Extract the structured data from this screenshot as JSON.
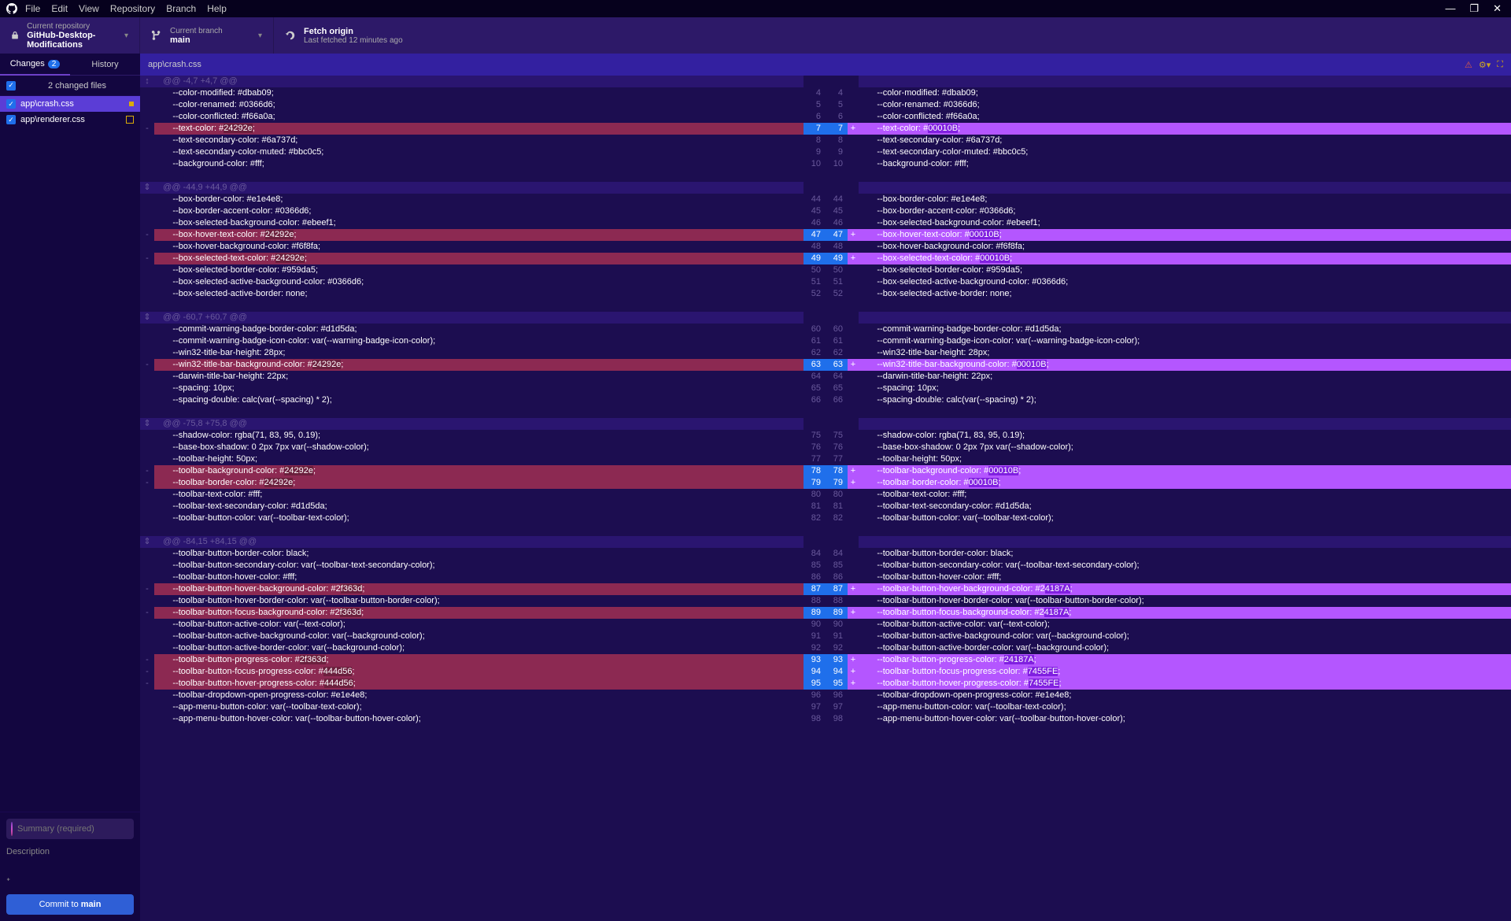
{
  "menubar": [
    "File",
    "Edit",
    "View",
    "Repository",
    "Branch",
    "Help"
  ],
  "repo": {
    "label": "Current repository",
    "value": "GitHub-Desktop-Modifications"
  },
  "branch": {
    "label": "Current branch",
    "value": "main"
  },
  "fetch": {
    "title": "Fetch origin",
    "sub": "Last fetched 12 minutes ago"
  },
  "tabs": {
    "changes": "Changes",
    "changes_count": "2",
    "history": "History"
  },
  "changed_header": "2 changed files",
  "files": [
    {
      "path": "app\\crash.css",
      "active": true,
      "icon": "dot"
    },
    {
      "path": "app\\renderer.css",
      "active": false,
      "icon": "square"
    }
  ],
  "filebar": "app\\crash.css",
  "commit": {
    "summary_ph": "Summary (required)",
    "desc": "Description",
    "button_pre": "Commit to ",
    "button_branch": "main"
  },
  "diff": [
    {
      "t": "hunk",
      "gut": "↕",
      "txt": "@@ -4,7 +4,7 @@"
    },
    {
      "t": "ctx",
      "l": "4",
      "r": "4",
      "txt": "    --color-modified: #dbab09;"
    },
    {
      "t": "ctx",
      "l": "5",
      "r": "5",
      "txt": "    --color-renamed: #0366d6;"
    },
    {
      "t": "ctx",
      "l": "6",
      "r": "6",
      "txt": "    --color-conflicted: #f66a0a;"
    },
    {
      "t": "chg",
      "l": "7",
      "r": "7",
      "old": "    --text-color: #",
      "oldh": "24292e",
      "olde": ";",
      "new": "    --text-color: #",
      "newh": "00010B",
      "newe": ";"
    },
    {
      "t": "ctx",
      "l": "8",
      "r": "8",
      "txt": "    --text-secondary-color: #6a737d;"
    },
    {
      "t": "ctx",
      "l": "9",
      "r": "9",
      "txt": "    --text-secondary-color-muted: #bbc0c5;"
    },
    {
      "t": "ctx",
      "l": "10",
      "r": "10",
      "txt": "    --background-color: #fff;"
    },
    {
      "t": "hunk",
      "gut": "⇕",
      "txt": "@@ -44,9 +44,9 @@"
    },
    {
      "t": "ctx",
      "l": "44",
      "r": "44",
      "txt": "    --box-border-color: #e1e4e8;"
    },
    {
      "t": "ctx",
      "l": "45",
      "r": "45",
      "txt": "    --box-border-accent-color: #0366d6;"
    },
    {
      "t": "ctx",
      "l": "46",
      "r": "46",
      "txt": "    --box-selected-background-color: #ebeef1;"
    },
    {
      "t": "chg",
      "l": "47",
      "r": "47",
      "old": "    --box-hover-text-color: #",
      "oldh": "24292e",
      "olde": ";",
      "new": "    --box-hover-text-color: #",
      "newh": "00010B",
      "newe": ";"
    },
    {
      "t": "ctx",
      "l": "48",
      "r": "48",
      "txt": "    --box-hover-background-color: #f6f8fa;"
    },
    {
      "t": "chg",
      "l": "49",
      "r": "49",
      "old": "    --box-selected-text-color: #",
      "oldh": "24292e",
      "olde": ";",
      "new": "    --box-selected-text-color: #",
      "newh": "00010B",
      "newe": ";"
    },
    {
      "t": "ctx",
      "l": "50",
      "r": "50",
      "txt": "    --box-selected-border-color: #959da5;"
    },
    {
      "t": "ctx",
      "l": "51",
      "r": "51",
      "txt": "    --box-selected-active-background-color: #0366d6;"
    },
    {
      "t": "ctx",
      "l": "52",
      "r": "52",
      "txt": "    --box-selected-active-border: none;"
    },
    {
      "t": "hunk",
      "gut": "⇕",
      "txt": "@@ -60,7 +60,7 @@"
    },
    {
      "t": "ctx",
      "l": "60",
      "r": "60",
      "txt": "    --commit-warning-badge-border-color: #d1d5da;"
    },
    {
      "t": "ctx",
      "l": "61",
      "r": "61",
      "txt": "    --commit-warning-badge-icon-color: var(--warning-badge-icon-color);"
    },
    {
      "t": "ctx",
      "l": "62",
      "r": "62",
      "txt": "    --win32-title-bar-height: 28px;"
    },
    {
      "t": "chg",
      "l": "63",
      "r": "63",
      "old": "    --win32-title-bar-background-color: #",
      "oldh": "24292e",
      "olde": ";",
      "new": "    --win32-title-bar-background-color: #",
      "newh": "00010B",
      "newe": ";"
    },
    {
      "t": "ctx",
      "l": "64",
      "r": "64",
      "txt": "    --darwin-title-bar-height: 22px;"
    },
    {
      "t": "ctx",
      "l": "65",
      "r": "65",
      "txt": "    --spacing: 10px;"
    },
    {
      "t": "ctx",
      "l": "66",
      "r": "66",
      "txt": "    --spacing-double: calc(var(--spacing) * 2);"
    },
    {
      "t": "hunk",
      "gut": "⇕",
      "txt": "@@ -75,8 +75,8 @@"
    },
    {
      "t": "ctx",
      "l": "75",
      "r": "75",
      "txt": "    --shadow-color: rgba(71, 83, 95, 0.19);"
    },
    {
      "t": "ctx",
      "l": "76",
      "r": "76",
      "txt": "    --base-box-shadow: 0 2px 7px var(--shadow-color);"
    },
    {
      "t": "ctx",
      "l": "77",
      "r": "77",
      "txt": "    --toolbar-height: 50px;"
    },
    {
      "t": "chg",
      "l": "78",
      "r": "78",
      "old": "    --toolbar-background-color: #",
      "oldh": "24292e",
      "olde": ";",
      "new": "    --toolbar-background-color: #",
      "newh": "00010B",
      "newe": ";"
    },
    {
      "t": "chg",
      "l": "79",
      "r": "79",
      "old": "    --toolbar-border-color: #",
      "oldh": "24292e",
      "olde": ";",
      "new": "    --toolbar-border-color: #",
      "newh": "00010B",
      "newe": ";"
    },
    {
      "t": "ctx",
      "l": "80",
      "r": "80",
      "txt": "    --toolbar-text-color: #fff;"
    },
    {
      "t": "ctx",
      "l": "81",
      "r": "81",
      "txt": "    --toolbar-text-secondary-color: #d1d5da;"
    },
    {
      "t": "ctx",
      "l": "82",
      "r": "82",
      "txt": "    --toolbar-button-color: var(--toolbar-text-color);"
    },
    {
      "t": "hunk",
      "gut": "⇕",
      "txt": "@@ -84,15 +84,15 @@"
    },
    {
      "t": "ctx",
      "l": "84",
      "r": "84",
      "txt": "    --toolbar-button-border-color: black;"
    },
    {
      "t": "ctx",
      "l": "85",
      "r": "85",
      "txt": "    --toolbar-button-secondary-color: var(--toolbar-text-secondary-color);"
    },
    {
      "t": "ctx",
      "l": "86",
      "r": "86",
      "txt": "    --toolbar-button-hover-color: #fff;"
    },
    {
      "t": "chg",
      "l": "87",
      "r": "87",
      "old": "    --toolbar-button-hover-background-color: #2",
      "oldh": "f363d",
      "olde": ";",
      "new": "    --toolbar-button-hover-background-color: #2",
      "newh": "4187A",
      "newe": ";"
    },
    {
      "t": "ctx",
      "l": "88",
      "r": "88",
      "txt": "    --toolbar-button-hover-border-color: var(--toolbar-button-border-color);"
    },
    {
      "t": "chg",
      "l": "89",
      "r": "89",
      "old": "    --toolbar-button-focus-background-color: #2",
      "oldh": "f363d",
      "olde": ";",
      "new": "    --toolbar-button-focus-background-color: #2",
      "newh": "4187A",
      "newe": ";"
    },
    {
      "t": "ctx",
      "l": "90",
      "r": "90",
      "txt": "    --toolbar-button-active-color: var(--text-color);"
    },
    {
      "t": "ctx",
      "l": "91",
      "r": "91",
      "txt": "    --toolbar-button-active-background-color: var(--background-color);"
    },
    {
      "t": "ctx",
      "l": "92",
      "r": "92",
      "txt": "    --toolbar-button-active-border-color: var(--background-color);"
    },
    {
      "t": "chg",
      "l": "93",
      "r": "93",
      "old": "    --toolbar-button-progress-color: #",
      "oldh": "2f363d",
      "olde": ";",
      "new": "    --toolbar-button-progress-color: #",
      "newh": "24187A",
      "newe": ";"
    },
    {
      "t": "chg",
      "l": "94",
      "r": "94",
      "old": "    --toolbar-button-focus-progress-color: #",
      "oldh": "444d56",
      "olde": ";",
      "new": "    --toolbar-button-focus-progress-color: #",
      "newh": "7455FE",
      "newe": ";"
    },
    {
      "t": "chg",
      "l": "95",
      "r": "95",
      "old": "    --toolbar-button-hover-progress-color: #",
      "oldh": "444d56",
      "olde": ";",
      "new": "    --toolbar-button-hover-progress-color: #",
      "newh": "7455FE",
      "newe": ";"
    },
    {
      "t": "ctx",
      "l": "96",
      "r": "96",
      "txt": "    --toolbar-dropdown-open-progress-color: #e1e4e8;"
    },
    {
      "t": "ctx",
      "l": "97",
      "r": "97",
      "txt": "    --app-menu-button-color: var(--toolbar-text-color);"
    },
    {
      "t": "ctx",
      "l": "98",
      "r": "98",
      "txt": "    --app-menu-button-hover-color: var(--toolbar-button-hover-color);"
    }
  ]
}
